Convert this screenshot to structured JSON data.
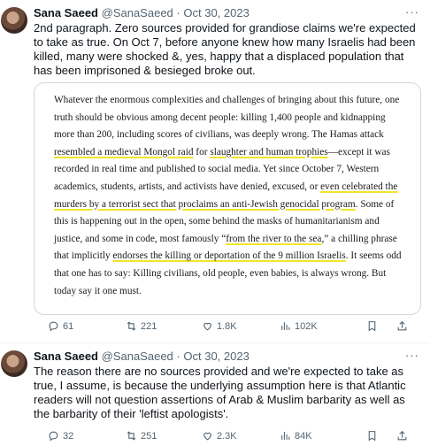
{
  "tweets": [
    {
      "author_name": "Sana Saeed",
      "handle": "@SanaSaeed",
      "separator": "·",
      "date": "Oct 30, 2023",
      "more_icon": "more-icon",
      "text": "2nd paragraph. Zero sources provided for grandiose claims we're expected to take as true. On Oct 7, before anyone knew how many Israelis had been killed, many were shocked &, yes, happy that a displaced population that has been imprisoned & besieged broke out.",
      "media_excerpt": {
        "segments": [
          {
            "text": "Whatever the enormous complexities and challenges of bringing about this future, one truth should be obvious among decent people: killing 1,400 people and kidnapping more than 200, including scores of civilians, was deeply wrong. The Hamas attack ",
            "highlight": false
          },
          {
            "text": "resembled a medieval Mongol raid",
            "highlight": true
          },
          {
            "text": " for ",
            "highlight": false
          },
          {
            "text": "slaughter and human trophies",
            "highlight": true
          },
          {
            "text": "—except it was recorded in real time and published to social media. Yet since October 7, Western academics, students, artists, and activists have denied, excused, or ",
            "highlight": false
          },
          {
            "text": "even celebrated the murders by a terrorist sect that proclaims an anti-Jewish genocidal program",
            "highlight": true
          },
          {
            "text": ". Some of this is happening out in the open, some behind the masks of humanitarianism and justice, and some in code, most famously “",
            "highlight": false
          },
          {
            "text": "from the river to the sea",
            "highlight": true
          },
          {
            "text": ",” a chilling phrase that implicitly ",
            "highlight": false
          },
          {
            "text": "endorses the killing or deportation of the 9 million Israelis",
            "highlight": true
          },
          {
            "text": ". It seems odd that one has to say: Killing civilians, old people, even babies, is always wrong. But today say it one must.",
            "highlight": false
          }
        ]
      },
      "stats": {
        "replies": "61",
        "retweets": "221",
        "likes": "1.8K",
        "views": "102K"
      }
    },
    {
      "author_name": "Sana Saeed",
      "handle": "@SanaSaeed",
      "separator": "·",
      "date": "Oct 30, 2023",
      "more_icon": "more-icon",
      "text": "The reason there are no sources provided and we're expected to take as true, I assume, is because the underlying assumption here is that Atlantic readers will not question assertions of  Arab & Muslim barbarity as well as the barbarity of their 'leftist apologists'.",
      "stats": {
        "replies": "32",
        "retweets": "251",
        "likes": "2.3K",
        "views": "84K"
      }
    }
  ],
  "colors": {
    "text": "#0f1419",
    "muted": "#536471",
    "highlight": "#f2e42a",
    "border": "#cfd9de"
  },
  "icons": [
    "reply-icon",
    "retweet-icon",
    "like-icon",
    "views-icon",
    "bookmark-icon",
    "share-icon"
  ]
}
